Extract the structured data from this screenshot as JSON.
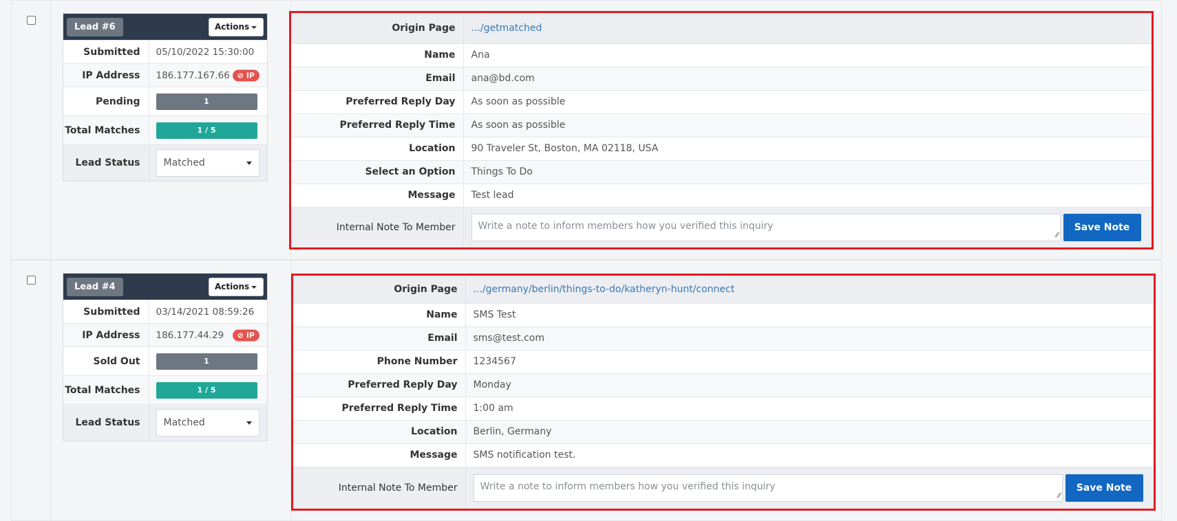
{
  "leads": [
    {
      "badge": "Lead #6",
      "actions_label": "Actions",
      "submitted_label": "Submitted",
      "submitted_value": "05/10/2022 15:30:00",
      "ip_label": "IP Address",
      "ip_value": "186.177.167.66",
      "ip_badge": "⊘ IP",
      "queue_label": "Pending",
      "queue_value": "1",
      "total_label": "Total Matches",
      "total_value": "1 / 5",
      "status_label": "Lead Status",
      "status_value": "Matched",
      "details": [
        {
          "label": "Origin Page",
          "value": ".../getmatched",
          "link": true
        },
        {
          "label": "Name",
          "value": "Ana"
        },
        {
          "label": "Email",
          "value": "ana@bd.com"
        },
        {
          "label": "Preferred Reply Day",
          "value": "As soon as possible"
        },
        {
          "label": "Preferred Reply Time",
          "value": "As soon as possible"
        },
        {
          "label": "Location",
          "value": "90 Traveler St, Boston, MA 02118, USA"
        },
        {
          "label": "Select an Option",
          "value": "Things To Do"
        },
        {
          "label": "Message",
          "value": "Test lead"
        }
      ],
      "note_label": "Internal Note To Member",
      "note_placeholder": "Write a note to inform members how you verified this inquiry",
      "save_label": "Save Note"
    },
    {
      "badge": "Lead #4",
      "actions_label": "Actions",
      "submitted_label": "Submitted",
      "submitted_value": "03/14/2021 08:59:26",
      "ip_label": "IP Address",
      "ip_value": "186.177.44.29",
      "ip_badge": "⊘ IP",
      "queue_label": "Sold Out",
      "queue_value": "1",
      "total_label": "Total Matches",
      "total_value": "1 / 5",
      "status_label": "Lead Status",
      "status_value": "Matched",
      "details": [
        {
          "label": "Origin Page",
          "value": ".../germany/berlin/things-to-do/katheryn-hunt/connect",
          "link": true
        },
        {
          "label": "Name",
          "value": "SMS Test"
        },
        {
          "label": "Email",
          "value": "sms@test.com"
        },
        {
          "label": "Phone Number",
          "value": "1234567"
        },
        {
          "label": "Preferred Reply Day",
          "value": "Monday"
        },
        {
          "label": "Preferred Reply Time",
          "value": "1:00 am"
        },
        {
          "label": "Location",
          "value": "Berlin, Germany"
        },
        {
          "label": "Message",
          "value": "SMS notification test."
        }
      ],
      "note_label": "Internal Note To Member",
      "note_placeholder": "Write a note to inform members how you verified this inquiry",
      "save_label": "Save Note"
    }
  ]
}
